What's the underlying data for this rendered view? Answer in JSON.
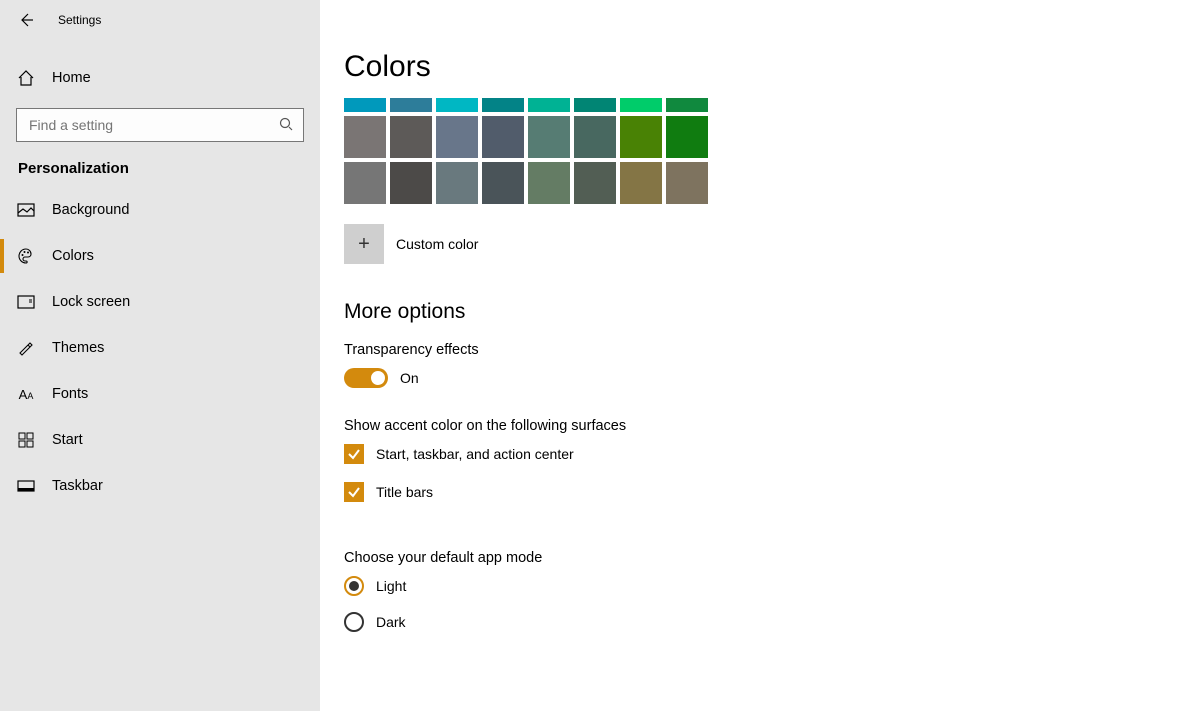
{
  "window_title": "Settings",
  "accent_color": "#d38a0d",
  "sidebar": {
    "home_label": "Home",
    "search_placeholder": "Find a setting",
    "section_caption": "Personalization",
    "items": [
      {
        "key": "background",
        "label": "Background",
        "active": false
      },
      {
        "key": "colors",
        "label": "Colors",
        "active": true
      },
      {
        "key": "lockscreen",
        "label": "Lock screen",
        "active": false
      },
      {
        "key": "themes",
        "label": "Themes",
        "active": false
      },
      {
        "key": "fonts",
        "label": "Fonts",
        "active": false
      },
      {
        "key": "start",
        "label": "Start",
        "active": false
      },
      {
        "key": "taskbar",
        "label": "Taskbar",
        "active": false
      }
    ]
  },
  "page": {
    "title": "Colors",
    "swatches": {
      "row_thin": [
        "#0099bc",
        "#2d7d9a",
        "#00b7c3",
        "#038387",
        "#00b294",
        "#018574",
        "#00cc6a",
        "#10893e"
      ],
      "row_a": [
        "#7a7574",
        "#5d5a58",
        "#68768a",
        "#515c6b",
        "#567c73",
        "#486860",
        "#498205",
        "#107c10"
      ],
      "row_b": [
        "#767676",
        "#4c4a48",
        "#69797e",
        "#4a5459",
        "#647c64",
        "#525e54",
        "#847545",
        "#7e735f"
      ]
    },
    "custom_color_label": "Custom color",
    "more_options_title": "More options",
    "transparency": {
      "label": "Transparency effects",
      "state_label": "On",
      "on": true
    },
    "accent_surfaces": {
      "label": "Show accent color on the following surfaces",
      "options": [
        {
          "label": "Start, taskbar, and action center",
          "checked": true
        },
        {
          "label": "Title bars",
          "checked": true
        }
      ]
    },
    "app_mode": {
      "label": "Choose your default app mode",
      "options": [
        {
          "label": "Light",
          "selected": true
        },
        {
          "label": "Dark",
          "selected": false
        }
      ]
    }
  }
}
